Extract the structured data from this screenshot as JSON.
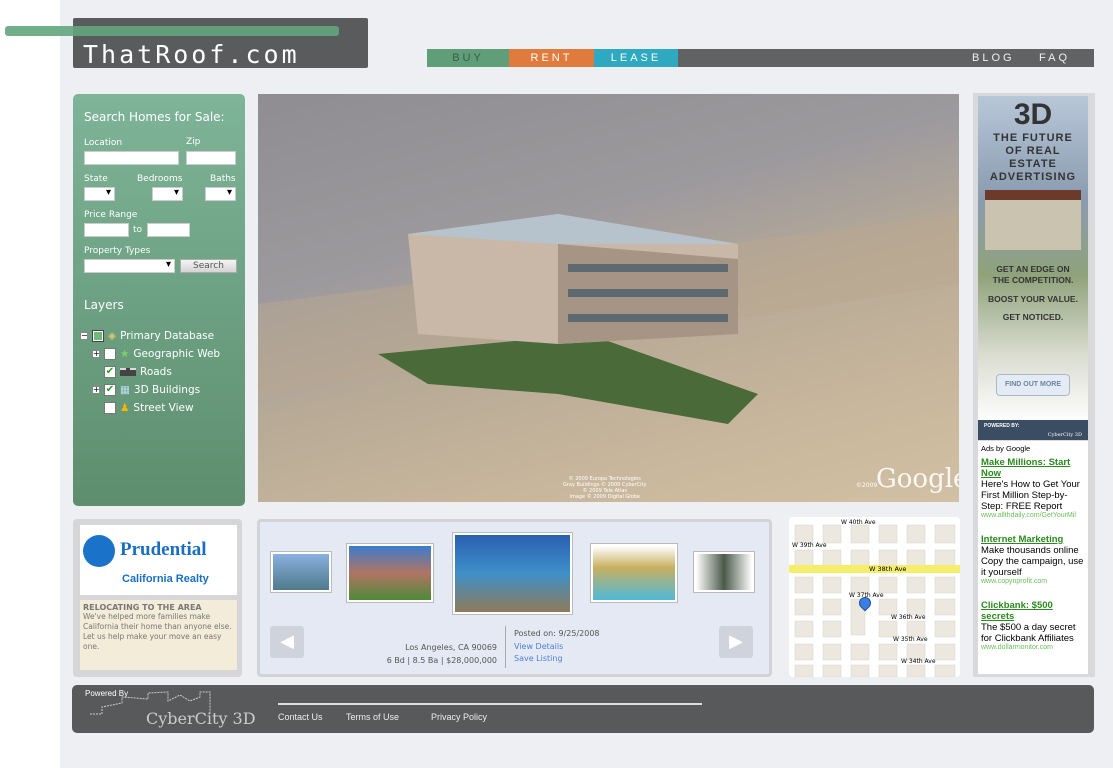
{
  "header": {
    "logo": "ThatRoof.com",
    "nav": {
      "buy": "BUY",
      "rent": "RENT",
      "lease": "LEASE",
      "blog": "BLOG",
      "faq": "FAQ"
    }
  },
  "search": {
    "title": "Search Homes for Sale:",
    "location": "Location",
    "zip": "Zip",
    "state": "State",
    "bedrooms": "Bedrooms",
    "baths": "Baths",
    "price_range": "Price Range",
    "to": "to",
    "property_types": "Property Types",
    "search_button": "Search"
  },
  "layers": {
    "title": "Layers",
    "items": [
      {
        "label": "Primary Database",
        "checked": "partial"
      },
      {
        "label": "Geographic Web",
        "checked": false
      },
      {
        "label": "Roads",
        "checked": true
      },
      {
        "label": "3D Buildings",
        "checked": true
      },
      {
        "label": "Street View",
        "checked": false
      }
    ]
  },
  "viewer": {
    "attribution": [
      "© 2009 Europa Technologies",
      "Gray Buildings © 2009 CyberCity",
      "© 2009 Tele Atlas",
      "Image © 2009 Digital Globe"
    ],
    "brand": "Google",
    "brand_year": "©2009"
  },
  "ad": {
    "big": "3D",
    "headline": "THE FUTURE OF REAL ESTATE ADVERTISING",
    "line1": "GET AN EDGE ON THE COMPETITION.",
    "line2": "BOOST YOUR VALUE.",
    "line3": "GET NOTICED.",
    "cta": "FIND OUT MORE",
    "powered": "POWERED BY:",
    "brand": "CyberCity 3D"
  },
  "google_ads": {
    "label": "Ads by Google",
    "items": [
      {
        "title": "Make Millions: Start Now",
        "body": "Here's How to Get Your First Million Step-by-Step: FREE Report",
        "url": "www.allthdaily.com/GetYourMil"
      },
      {
        "title": "Internet Marketing",
        "body": "Make thousands online Copy the campaign, use it yourself",
        "url": "www.copynprofit.com"
      },
      {
        "title": "Clickbank: $500 secrets",
        "body": "The $500 a day secret for Clickbank Affiliates",
        "url": "www.dollarmonitor.com"
      }
    ]
  },
  "prudential": {
    "name": "Prudential",
    "sub": "California Realty",
    "heading": "RELOCATING TO THE AREA",
    "body": "We've helped more families make California their home than anyone else. Let us help make your move an easy one."
  },
  "listing": {
    "location": "Los Angeles, CA 90069",
    "details": "6 Bd | 8.5 Ba | $28,000,000",
    "posted": "Posted on: 9/25/2008",
    "view": "View Details",
    "save": "Save Listing"
  },
  "map": {
    "streets": [
      "W 40th Ave",
      "W 39th Ave",
      "W 38th Ave",
      "W 37th Ave",
      "W 36th Ave",
      "W 35th Ave",
      "W 34th Ave"
    ]
  },
  "footer": {
    "powered": "Powered By",
    "brand": "CyberCity 3D",
    "links": [
      "Contact Us",
      "Terms of Use",
      "Privacy Policy"
    ]
  }
}
